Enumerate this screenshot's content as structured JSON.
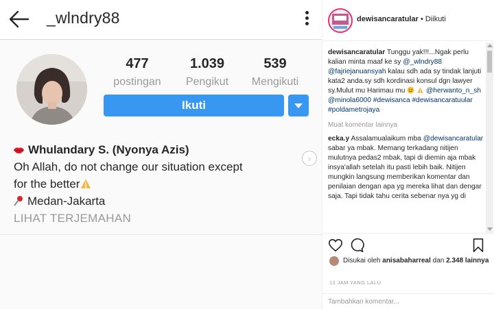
{
  "profile": {
    "username": "_wlndry88",
    "stats": [
      {
        "value": "477",
        "label": "postingan"
      },
      {
        "value": "1.039",
        "label": "Pengikut"
      },
      {
        "value": "539",
        "label": "Mengikuti"
      }
    ],
    "follow_label": "Ikuti",
    "bio": {
      "display_name": "Whulandary S. (Nyonya Azis)",
      "line1": "Oh Allah, do not change our situation except",
      "line2": "for the better",
      "location": "Medan-Jakarta",
      "translate_label": "LIHAT TERJEMAHAN"
    },
    "icons": {
      "back": "arrow-left-icon",
      "more": "more-vertical-icon",
      "lips": "kiss-lips-icon",
      "pin": "pushpin-icon",
      "pray": "praying-hands-icon"
    },
    "colors": {
      "follow_button": "#3897f0",
      "muted": "#999999",
      "text": "#262626"
    }
  },
  "post": {
    "author": "dewisancaratular",
    "follow_state": "Diikuti",
    "caption": {
      "author": "dewisancaratular",
      "t1": "Tunggu yak!!!...Ngak perlu kalian minta maaf ke sy",
      "m1": "@_wlndry88",
      "m2": "@fajriejanuansyah",
      "t2": "kalau sdh ada sy tindak lanjuti kata2 anda.sy sdh kordinasi konsul dgn lawyer sy.Mulut mu Harimau mu",
      "m3": "@herwanto_n_sh",
      "m4": "@minola6000",
      "tags": "#dewisanca #dewisancaratuular #poldametrojaya"
    },
    "load_more": "Muat komentar lainnya",
    "comment": {
      "author": "ecka.y",
      "t1": "Assalamualaikum mba",
      "m1": "@dewisancaratular",
      "t2": "sabar ya mbak. Memang terkadang nitijen mulutnya pedas2 mbak, tapi di diemin aja mbak insya'allah setelah itu pasti lebih baik. Nitijen mungkin langsung memberikan komentar dan penilaian dengan apa yg mereka lihat dan dengar saja. Tapi tidak tahu cerita sebenar nya yg di"
    },
    "likes": {
      "prefix": "Disukai oleh",
      "user": "anisabaharreal",
      "mid": "dan",
      "count": "2.348 lainnya"
    },
    "time_ago": "12 JAM YANG LALU",
    "comment_placeholder": "Tambahkan komentar...",
    "icons": {
      "like": "heart-icon",
      "comment": "comment-bubble-icon",
      "save": "bookmark-icon"
    },
    "colors": {
      "link": "#003569",
      "story_ring": "#e1306c"
    }
  }
}
